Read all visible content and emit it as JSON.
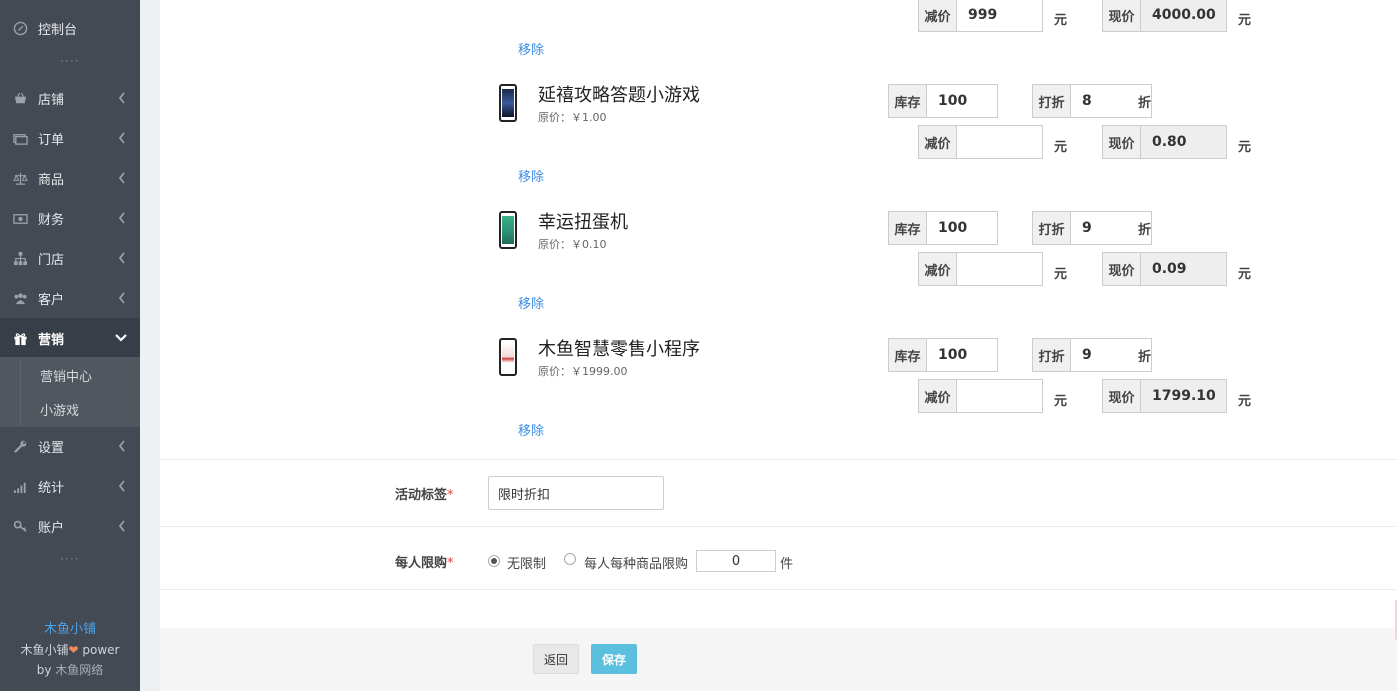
{
  "sidebar": {
    "items": [
      {
        "label": "控制台",
        "icon": "dashboard-icon"
      },
      {
        "label": "店铺",
        "icon": "basket-icon"
      },
      {
        "label": "订单",
        "icon": "money-icon"
      },
      {
        "label": "商品",
        "icon": "scale-icon"
      },
      {
        "label": "财务",
        "icon": "cash-icon"
      },
      {
        "label": "门店",
        "icon": "sitemap-icon"
      },
      {
        "label": "客户",
        "icon": "users-icon"
      },
      {
        "label": "营销",
        "icon": "gift-icon"
      },
      {
        "label": "设置",
        "icon": "wrench-icon"
      },
      {
        "label": "统计",
        "icon": "signal-icon"
      },
      {
        "label": "账户",
        "icon": "key-icon"
      }
    ],
    "dots": "····",
    "submenu": [
      {
        "label": "营销中心"
      },
      {
        "label": "小游戏"
      }
    ],
    "brand": {
      "name": "木鱼小铺",
      "power_a": "木鱼小铺",
      "heart": "❤",
      "power_b": " power",
      "by_a": "by ",
      "by_b": "木鱼网络"
    }
  },
  "products": [
    {
      "name": "",
      "orig": "",
      "stock": "",
      "discount": "",
      "reduce": "999",
      "current": "4000.00",
      "remove": "移除"
    },
    {
      "name": "延禧攻略答题小游戏",
      "orig": "原价：￥1.00",
      "stock": "100",
      "discount": "8",
      "reduce": "",
      "current": "0.80",
      "remove": "移除"
    },
    {
      "name": "幸运扭蛋机",
      "orig": "原价：￥0.10",
      "stock": "100",
      "discount": "9",
      "reduce": "",
      "current": "0.09",
      "remove": "移除"
    },
    {
      "name": "木鱼智慧零售小程序",
      "orig": "原价：￥1999.00",
      "stock": "100",
      "discount": "9",
      "reduce": "",
      "current": "1799.10",
      "remove": "移除"
    }
  ],
  "labels": {
    "stock": "库存",
    "discount": "打折",
    "discount_suffix": "折",
    "reduce": "减价",
    "current": "现价",
    "yuan": "元"
  },
  "form": {
    "tag_label": "活动标签",
    "tag_value": "限时折扣",
    "limit_label": "每人限购",
    "required": "*",
    "opt_unlimited": "无限制",
    "opt_per_item": "每人每种商品限购",
    "limit_value": "0",
    "limit_unit": "件"
  },
  "buttons": {
    "back": "返回",
    "save": "保存"
  }
}
